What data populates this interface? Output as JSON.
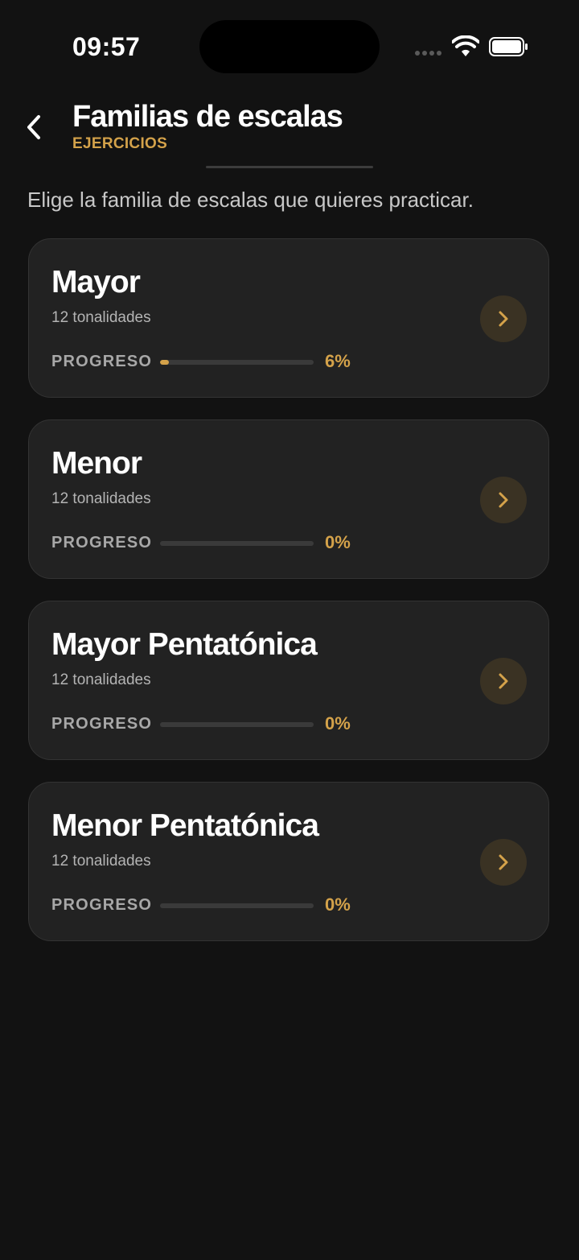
{
  "status": {
    "time": "09:57"
  },
  "header": {
    "title": "Familias de escalas",
    "subtitle": "EJERCICIOS",
    "back_icon": "chevron-left-icon"
  },
  "intro": "Elige la familia de escalas que quieres practicar.",
  "accent_color": "#d4a24a",
  "cards": [
    {
      "title": "Mayor",
      "subtitle": "12 tonalidades",
      "progress_label": "PROGRESO",
      "progress": 0.06,
      "progress_text": "6%"
    },
    {
      "title": "Menor",
      "subtitle": "12 tonalidades",
      "progress_label": "PROGRESO",
      "progress": 0,
      "progress_text": "0%"
    },
    {
      "title": "Mayor Pentatónica",
      "subtitle": "12 tonalidades",
      "progress_label": "PROGRESO",
      "progress": 0,
      "progress_text": "0%"
    },
    {
      "title": "Menor Pentatónica",
      "subtitle": "12 tonalidades",
      "progress_label": "PROGRESO",
      "progress": 0,
      "progress_text": "0%"
    }
  ]
}
